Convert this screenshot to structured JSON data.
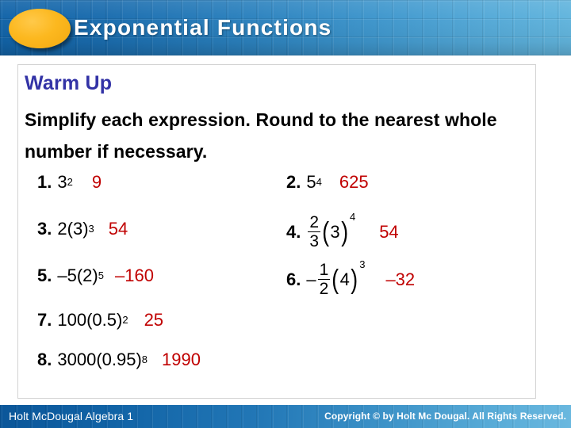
{
  "header": {
    "title": "Exponential Functions",
    "bullet_color": "#fcb81f",
    "bg_from": "#1163a8",
    "bg_to": "#63b6de"
  },
  "content": {
    "warmup_label": "Warm Up",
    "warmup_color": "#3333a6",
    "instructions": "Simplify each expression. Round to the nearest whole number if necessary.",
    "answer_color": "#c00000"
  },
  "problems": [
    {
      "number": "1.",
      "expression_plain": "3²",
      "base": "3",
      "exponent": "2",
      "answer": "9",
      "kind": "power"
    },
    {
      "number": "2.",
      "expression_plain": "5⁴",
      "base": "5",
      "exponent": "4",
      "answer": "625",
      "kind": "power"
    },
    {
      "number": "3.",
      "expression_plain": "2(3)³",
      "coefficient": "2",
      "base": "3",
      "exponent": "3",
      "answer": "54",
      "kind": "coef-power"
    },
    {
      "number": "4.",
      "expression_plain": "(2/3)(3)⁴",
      "frac_num": "2",
      "frac_den": "3",
      "base": "3",
      "exponent": "4",
      "sign": "",
      "answer": "54",
      "kind": "frac-power"
    },
    {
      "number": "5.",
      "expression_plain": "–5(2)⁵",
      "coefficient": "–5",
      "base": "2",
      "exponent": "5",
      "answer": "–160",
      "kind": "coef-power"
    },
    {
      "number": "6.",
      "expression_plain": "–(1/2)(4)³",
      "frac_num": "1",
      "frac_den": "2",
      "base": "4",
      "exponent": "3",
      "sign": "–",
      "answer": "–32",
      "kind": "frac-power"
    },
    {
      "number": "7.",
      "expression_plain": "100(0.5)²",
      "coefficient": "100",
      "base": "0.5",
      "exponent": "2",
      "answer": "25",
      "kind": "coef-power"
    },
    {
      "number": "8.",
      "expression_plain": "3000(0.95)⁸",
      "coefficient": "3000",
      "base": "0.95",
      "exponent": "8",
      "answer": "1990",
      "kind": "coef-power"
    }
  ],
  "footer": {
    "left": "Holt McDougal Algebra 1",
    "right": "Copyright © by Holt Mc Dougal. All Rights Reserved."
  }
}
